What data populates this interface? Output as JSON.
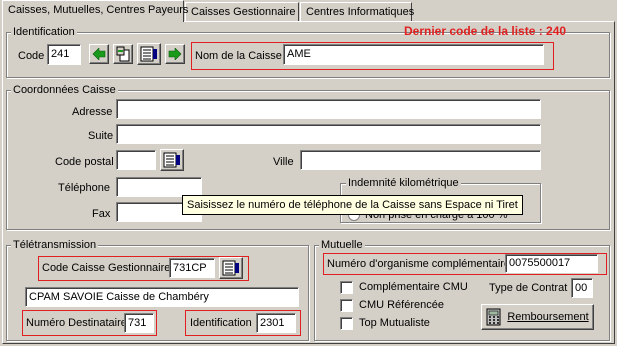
{
  "tabs": [
    {
      "label": "Caisses, Mutuelles, Centres Payeurs"
    },
    {
      "label": "Caisses Gestionnaire"
    },
    {
      "label": "Centres Informatiques"
    }
  ],
  "identification": {
    "legend": "Identification",
    "code_label": "Code",
    "code_value": "241",
    "last_code_text": "Dernier code de la liste : 240",
    "nom_label": "Nom de la Caisse",
    "nom_value": "AME"
  },
  "coordonnees": {
    "legend": "Coordonnées Caisse",
    "adresse_label": "Adresse",
    "adresse_value": "",
    "suite_label": "Suite",
    "suite_value": "",
    "cp_label": "Code postal",
    "cp_value": "",
    "ville_label": "Ville",
    "ville_value": "",
    "tel_label": "Téléphone",
    "tel_value": "",
    "fax_label": "Fax",
    "fax_value": "",
    "indemnite_legend": "Indemnité kilométrique",
    "indemnite_option": "Non prise en charge à 100 %"
  },
  "tooltip": "Saisissez le numéro de téléphone de la Caisse sans Espace ni Tiret",
  "teletransmission": {
    "legend": "Télétransmission",
    "code_gest_label": "Code Caisse Gestionnaire",
    "code_gest_value": "731CP",
    "caisse_name": "CPAM SAVOIE Caisse de Chambéry",
    "num_dest_label": "Numéro Destinataire",
    "num_dest_value": "731",
    "ident_label": "Identification",
    "ident_value": "2301"
  },
  "mutuelle": {
    "legend": "Mutuelle",
    "num_org_label": "Numéro d'organisme complémentaire",
    "num_org_value": "0075500017",
    "cmu_label": "Complémentaire CMU",
    "cmu_ref_label": "CMU Référencée",
    "top_label": "Top Mutualiste",
    "type_contrat_label": "Type de Contrat",
    "type_contrat_value": "00",
    "rembourse_label": "Remboursement"
  },
  "colors": {
    "red": "#e02020",
    "green_arrow": "#1a9a1a"
  }
}
